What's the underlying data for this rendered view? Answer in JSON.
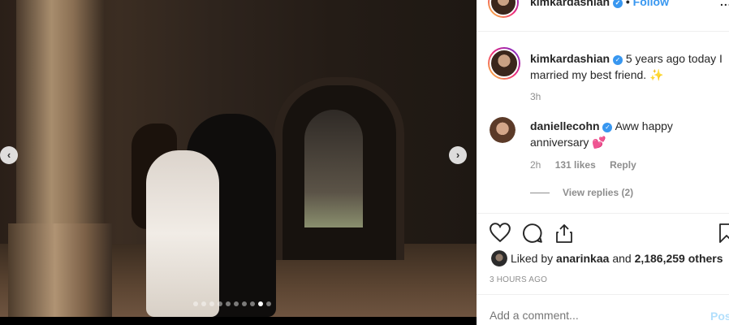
{
  "post": {
    "carousel": {
      "total_slides": 10,
      "active_slide": 9,
      "prev_icon": "chevron-left-icon",
      "next_icon": "chevron-right-icon"
    }
  },
  "header": {
    "username": "kimkardashian",
    "separator": "•",
    "follow_label": "Follow",
    "more_icon": "more-horizontal-icon",
    "more_text": "..."
  },
  "caption": {
    "username": "kimkardashian",
    "text": "5 years ago today I married my best friend. ✨",
    "time": "3h"
  },
  "comments": [
    {
      "username": "daniellecohn",
      "text": "Aww happy anniversary 💕",
      "time": "2h",
      "likes": "131 likes",
      "reply_label": "Reply",
      "view_replies": "View replies (2)"
    }
  ],
  "actions": {
    "icons": [
      "heart-icon",
      "comment-icon",
      "share-icon",
      "bookmark-icon"
    ]
  },
  "likes": {
    "prefix": "Liked by",
    "user": "anarinkaa",
    "and": "and",
    "count": "2,186,259 others"
  },
  "timestamp": "3 HOURS AGO",
  "add_comment": {
    "placeholder": "Add a comment...",
    "post_label": "Post"
  },
  "colors": {
    "accent": "#3897f0",
    "muted": "#8e8e8e",
    "post_disabled": "#b2dffc"
  }
}
